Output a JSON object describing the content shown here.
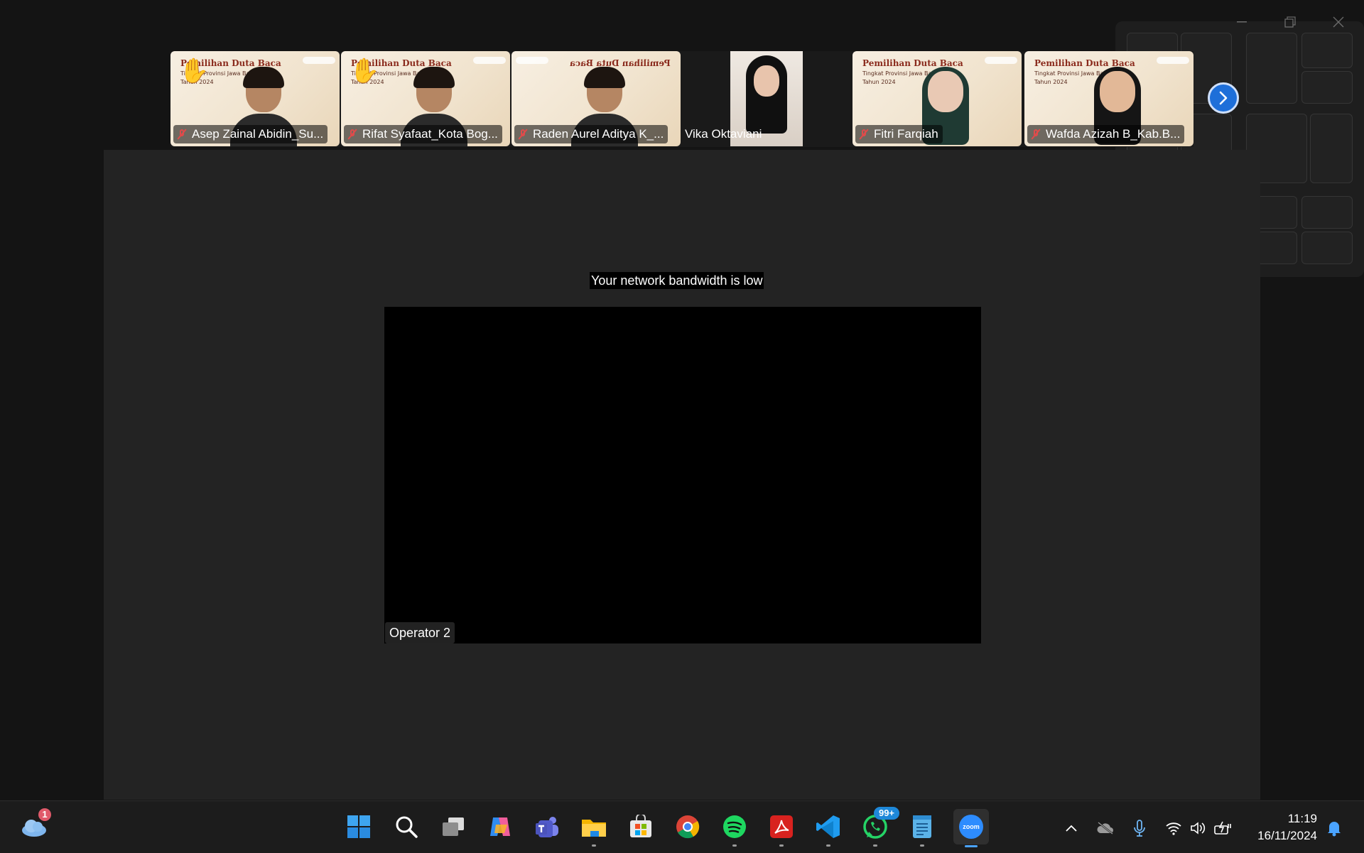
{
  "notice": {
    "bandwidth": "Your network bandwidth is low"
  },
  "poster": {
    "title": "Pemilihan Duta Baca",
    "subtitle": "Tingkat Provinsi Jawa Barat",
    "year": "Tahun 2024"
  },
  "participants": [
    {
      "name": "Asep Zainal Abidin_Su...",
      "muted": true,
      "hand_raised": true
    },
    {
      "name": "Rifat Syafaat_Kota Bog...",
      "muted": true,
      "hand_raised": true
    },
    {
      "name": "Raden Aurel Aditya K_...",
      "muted": true,
      "hand_raised": false
    },
    {
      "name": "Vika Oktaviani",
      "muted": false,
      "hand_raised": false
    },
    {
      "name": "Fitri Farqiah",
      "muted": true,
      "hand_raised": false
    },
    {
      "name": "Wafda Azizah B_Kab.B...",
      "muted": true,
      "hand_raised": false
    }
  ],
  "main_speaker": {
    "name": "Operator 2"
  },
  "taskbar": {
    "weather_badge": "1",
    "apps": [
      "start-icon",
      "search-icon",
      "task-view-icon",
      "copilot-icon",
      "teams-icon",
      "file-explorer-icon",
      "store-icon",
      "chrome-icon",
      "spotify-icon",
      "acrobat-icon",
      "vscode-icon",
      "whatsapp-icon",
      "notepad-icon",
      "zoom-icon"
    ],
    "whatsapp_badge": "99+",
    "zoom_label": "zoom",
    "time": "11:19",
    "date": "16/11/2024"
  },
  "colors": {
    "accent": "#1e6fd9",
    "muted_mic": "#e04b4b",
    "stage": "#232323"
  }
}
